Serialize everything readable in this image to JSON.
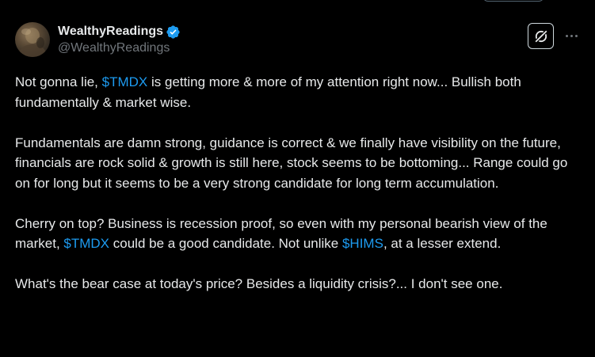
{
  "header": {
    "display_name": "WealthyReadings",
    "handle": "@WealthyReadings",
    "verified": true,
    "avatar_icon": "user-avatar-icon",
    "grok_icon": "grok-icon",
    "more_icon": "more-options-icon"
  },
  "colors": {
    "background": "#000000",
    "text": "#e7e9ea",
    "secondary_text": "#71767b",
    "link": "#1d9bf0",
    "verified_badge": "#1d9bf0"
  },
  "tweet": {
    "p1": {
      "t1": "Not gonna lie, ",
      "tag1": "$TMDX",
      "t2": " is getting more & more of my attention right now... Bullish both fundamentally & market wise."
    },
    "p2": {
      "t1": "Fundamentals are damn strong, guidance is correct & we finally have visibility on the future, financials are rock solid & growth is still here, stock seems to be bottoming... Range could go on for long but it seems to be a very strong candidate for long term accumulation."
    },
    "p3": {
      "t1": "Cherry on top? Business is recession proof, so even with my personal bearish view of the market, ",
      "tag1": "$TMDX",
      "t2": " could be a good candidate. Not unlike ",
      "tag2": "$HIMS",
      "t3": ", at a lesser extend."
    },
    "p4": {
      "t1": "What's the bear case at today's price? Besides a liquidity crisis?... I don't see one."
    }
  }
}
